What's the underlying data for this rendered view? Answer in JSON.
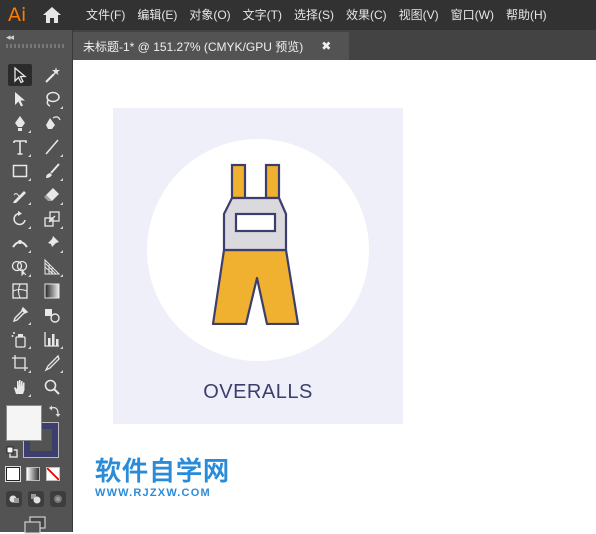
{
  "app": {
    "logo_text": "Ai",
    "logo_color": "#ff7c00"
  },
  "menu": [
    "文件(F)",
    "编辑(E)",
    "对象(O)",
    "文字(T)",
    "选择(S)",
    "效果(C)",
    "视图(V)",
    "窗口(W)",
    "帮助(H)"
  ],
  "document_tab": {
    "title": "未标题-1* @ 151.27% (CMYK/GPU 预览)",
    "close_glyph": "✖",
    "zoom": "151.27%",
    "color_mode": "CMYK/GPU 预览"
  },
  "panel": {
    "collapse_glyph": "◂◂"
  },
  "tools": [
    "selection-tool",
    "magic-wand-tool",
    "direct-selection-tool",
    "lasso-tool",
    "pen-tool",
    "curvature-tool",
    "type-tool",
    "line-segment-tool",
    "rectangle-tool",
    "paintbrush-tool",
    "shaper-tool",
    "eraser-tool",
    "rotate-tool",
    "scale-tool",
    "width-tool",
    "puppet-warp-tool",
    "shape-builder-tool",
    "perspective-grid-tool",
    "mesh-tool",
    "gradient-tool",
    "eyedropper-tool",
    "blend-tool",
    "symbol-sprayer-tool",
    "column-graph-tool",
    "artboard-tool",
    "slice-tool",
    "hand-tool",
    "zoom-tool"
  ],
  "colors": {
    "fill": "#f5f5f5",
    "stroke": "#3c3e6e",
    "artboard_bg": "#efeff9",
    "overalls_body": "#f0b030",
    "overalls_bib": "#d9d9de",
    "outline": "#3c3e6e"
  },
  "artwork": {
    "label": "OVERALLS"
  },
  "watermark": {
    "title": "软件自学网",
    "url": "WWW.RJZXW.COM",
    "color": "#2a8cd9"
  }
}
